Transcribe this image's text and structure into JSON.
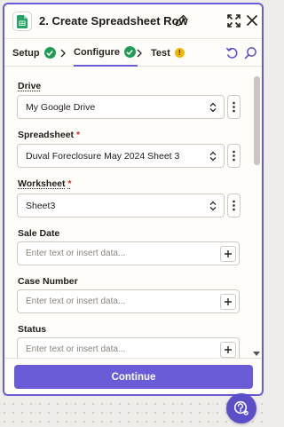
{
  "header": {
    "title": "2. Create Spreadsheet Row",
    "app_icon": "google-sheets-icon"
  },
  "tabs": [
    {
      "label": "Setup",
      "status": "complete"
    },
    {
      "label": "Configure",
      "status": "complete",
      "active": true
    },
    {
      "label": "Test",
      "status": "warning",
      "badge": "!"
    }
  ],
  "fields": {
    "drive": {
      "label": "Drive",
      "value": "My Google Drive"
    },
    "spreadsheet": {
      "label": "Spreadsheet",
      "required_mark": "*",
      "value": "Duval Foreclosure May 2024 Sheet 3"
    },
    "worksheet": {
      "label": "Worksheet",
      "required_mark": "*",
      "value": "Sheet3"
    },
    "sale_date": {
      "label": "Sale Date",
      "placeholder": "Enter text or insert data..."
    },
    "case_number": {
      "label": "Case Number",
      "placeholder": "Enter text or insert data..."
    },
    "status": {
      "label": "Status",
      "placeholder": "Enter text or insert data..."
    }
  },
  "footer": {
    "continue_label": "Continue"
  },
  "colors": {
    "accent": "#6a5bd6",
    "success": "#1f9d55",
    "warning": "#f2b705",
    "required": "#d3301f"
  }
}
